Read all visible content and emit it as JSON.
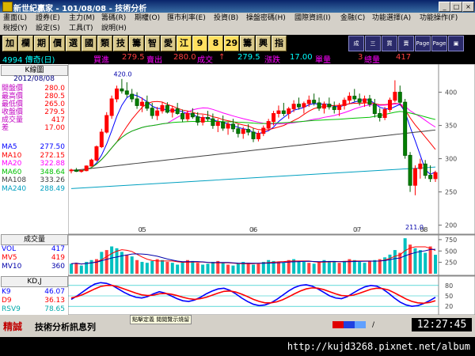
{
  "window": {
    "title": "新世紀贏家 - 101/08/08 - 技術分析",
    "btn_min": "_",
    "btn_max": "□",
    "btn_close": "×"
  },
  "menu": [
    "畫面(L)",
    "證券(E)",
    "主力(M)",
    "籌碼(R)",
    "期權(O)",
    "匯市利率(E)",
    "投資(B)",
    "操盤密碼(H)",
    "國際資訊(I)",
    "金融(C)",
    "功能選擇(A)",
    "功能操作(F)",
    "稅授(Y)",
    "設定(S)",
    "工具(T)",
    "說明(H)"
  ],
  "toolbar": {
    "buttons": [
      "加",
      "欄",
      "期",
      "價",
      "選",
      "國",
      "類",
      "技",
      "籌",
      "智",
      "愛",
      "江",
      "9",
      "8",
      "29",
      "籌",
      "興",
      "指"
    ],
    "icon_labels": [
      "成",
      "三",
      "買",
      "賣",
      "Page",
      "Page",
      "▣"
    ]
  },
  "info": {
    "code": "4994 傳奇(日)",
    "buy_label": "買進",
    "buy_value": "279.5",
    "sell_label": "賣出",
    "sell_value": "280.0",
    "trade_label": "成交",
    "arrow": "↑",
    "chg_value": "279.5",
    "vol_label": "漲跌",
    "chg": "17.00",
    "unit_label": "單量",
    "unit_value": "3",
    "total_label": "總量",
    "total_value": "417"
  },
  "left": {
    "k_header": "K線圖",
    "date": "2012/08/08",
    "ohlc": [
      {
        "label": "開盤價",
        "value": "280.0"
      },
      {
        "label": "最高價",
        "value": "280.5"
      },
      {
        "label": "最低價",
        "value": "265.0"
      },
      {
        "label": "收盤價",
        "value": "279.5"
      },
      {
        "label": "成交量",
        "value": "417"
      },
      {
        "label": "差",
        "value": "17.00"
      }
    ],
    "ma": [
      {
        "label": "MA5",
        "value": "277.50",
        "color": "#0000ff"
      },
      {
        "label": "MA10",
        "value": "272.15",
        "color": "#ff0000"
      },
      {
        "label": "MA20",
        "value": "322.88",
        "color": "#ff00ff"
      },
      {
        "label": "MA60",
        "value": "348.64",
        "color": "#00c000"
      },
      {
        "label": "MA108",
        "value": "333.26",
        "color": "#404040"
      },
      {
        "label": "MA240",
        "value": "288.49",
        "color": "#00a0c0"
      }
    ],
    "vol_header": "成交量",
    "vol": [
      {
        "label": "VOL",
        "value": "417",
        "color": "#0000ff"
      },
      {
        "label": "MV5",
        "value": "419",
        "color": "#ff0000"
      },
      {
        "label": "MV10",
        "value": "360",
        "color": "#0000aa"
      }
    ],
    "kd_header": "KD,J",
    "kd": [
      {
        "label": "K9",
        "value": "46.07",
        "color": "#0000ff"
      },
      {
        "label": "D9",
        "value": "36.13",
        "color": "#ff0000"
      },
      {
        "label": "RSV9",
        "value": "78.65",
        "color": "#00aaaa"
      }
    ]
  },
  "chart_data": [
    {
      "type": "candlestick",
      "title": "K線圖",
      "ylim": [
        190,
        440
      ],
      "yticks": [
        "400",
        "350",
        "300",
        "250",
        "200"
      ],
      "xticks": [
        "05",
        "06",
        "07",
        "08"
      ],
      "annotations": [
        "420.0",
        "211.0"
      ],
      "note": "approximate daily OHLC read from chart",
      "candles": [
        [
          282,
          285,
          278,
          283
        ],
        [
          283,
          286,
          280,
          281
        ],
        [
          281,
          284,
          279,
          282
        ],
        [
          282,
          290,
          281,
          289
        ],
        [
          289,
          300,
          288,
          298
        ],
        [
          298,
          320,
          296,
          318
        ],
        [
          318,
          345,
          316,
          340
        ],
        [
          340,
          370,
          338,
          365
        ],
        [
          365,
          395,
          360,
          390
        ],
        [
          390,
          410,
          385,
          405
        ],
        [
          405,
          420,
          398,
          402
        ],
        [
          402,
          415,
          392,
          397
        ],
        [
          397,
          405,
          385,
          390
        ],
        [
          390,
          400,
          375,
          380
        ],
        [
          380,
          392,
          370,
          385
        ],
        [
          385,
          395,
          372,
          376
        ],
        [
          376,
          384,
          360,
          365
        ],
        [
          365,
          378,
          358,
          372
        ],
        [
          372,
          385,
          368,
          380
        ],
        [
          380,
          385,
          368,
          370
        ],
        [
          370,
          380,
          362,
          375
        ],
        [
          375,
          384,
          366,
          368
        ],
        [
          368,
          374,
          355,
          360
        ],
        [
          360,
          372,
          356,
          368
        ],
        [
          368,
          376,
          360,
          363
        ],
        [
          363,
          370,
          350,
          355
        ],
        [
          355,
          366,
          350,
          362
        ],
        [
          362,
          372,
          356,
          360
        ],
        [
          360,
          368,
          345,
          350
        ],
        [
          350,
          360,
          340,
          355
        ],
        [
          355,
          365,
          342,
          346
        ],
        [
          346,
          356,
          336,
          352
        ],
        [
          352,
          360,
          340,
          345
        ],
        [
          345,
          352,
          332,
          338
        ],
        [
          338,
          348,
          330,
          344
        ],
        [
          344,
          352,
          335,
          340
        ],
        [
          340,
          346,
          325,
          330
        ],
        [
          330,
          342,
          326,
          338
        ],
        [
          338,
          350,
          334,
          346
        ],
        [
          346,
          360,
          342,
          356
        ],
        [
          356,
          372,
          350,
          368
        ],
        [
          368,
          380,
          362,
          372
        ],
        [
          372,
          384,
          364,
          368
        ],
        [
          368,
          378,
          360,
          375
        ],
        [
          375,
          388,
          370,
          382
        ],
        [
          382,
          392,
          374,
          378
        ],
        [
          378,
          386,
          368,
          383
        ],
        [
          383,
          395,
          378,
          388
        ],
        [
          388,
          398,
          380,
          384
        ],
        [
          384,
          392,
          372,
          376
        ],
        [
          376,
          386,
          368,
          382
        ],
        [
          382,
          392,
          374,
          378
        ],
        [
          378,
          386,
          368,
          374
        ],
        [
          374,
          384,
          364,
          380
        ],
        [
          380,
          392,
          374,
          388
        ],
        [
          388,
          400,
          382,
          394
        ],
        [
          394,
          405,
          386,
          390
        ],
        [
          390,
          398,
          380,
          385
        ],
        [
          385,
          395,
          378,
          390
        ],
        [
          390,
          396,
          378,
          382
        ],
        [
          382,
          390,
          362,
          368
        ],
        [
          368,
          376,
          356,
          362
        ],
        [
          362,
          378,
          358,
          374
        ],
        [
          374,
          392,
          370,
          388
        ],
        [
          388,
          418,
          385,
          400
        ],
        [
          400,
          410,
          380,
          385
        ],
        [
          385,
          390,
          300,
          305
        ],
        [
          305,
          310,
          250,
          260
        ],
        [
          260,
          290,
          245,
          285
        ],
        [
          285,
          300,
          270,
          292
        ],
        [
          292,
          298,
          270,
          275
        ],
        [
          275,
          290,
          265,
          270
        ],
        [
          270,
          282,
          265,
          279
        ]
      ],
      "series": [
        {
          "name": "MA5",
          "color": "#0000ff"
        },
        {
          "name": "MA10",
          "color": "#ff0000"
        },
        {
          "name": "MA20",
          "color": "#ff00ff"
        },
        {
          "name": "MA60",
          "color": "#00c000"
        },
        {
          "name": "MA108",
          "color": "#404040"
        },
        {
          "name": "MA240",
          "color": "#00a0c0"
        }
      ]
    },
    {
      "type": "bar",
      "title": "成交量",
      "ylim": [
        0,
        800
      ],
      "yticks": [
        "750",
        "500",
        "250"
      ],
      "values": [
        220,
        240,
        180,
        260,
        300,
        320,
        480,
        520,
        600,
        560,
        480,
        420,
        380,
        300,
        260,
        240,
        280,
        320,
        300,
        260,
        240,
        200,
        260,
        300,
        280,
        240,
        200,
        220,
        260,
        280,
        240,
        200,
        180,
        220,
        260,
        240,
        200,
        220,
        260,
        300,
        280,
        260,
        240,
        300,
        320,
        280,
        260,
        240,
        220,
        260,
        300,
        280,
        260,
        240,
        280,
        320,
        300,
        260,
        240,
        280,
        300,
        320,
        360,
        420,
        520,
        460,
        780,
        640,
        560,
        520,
        460,
        600,
        417
      ]
    },
    {
      "type": "line",
      "title": "KD,J",
      "ylim": [
        0,
        100
      ],
      "yticks": [
        "80",
        "50",
        "20"
      ],
      "series": [
        {
          "name": "K9",
          "color": "#0000ff",
          "values": [
            40,
            50,
            62,
            74,
            84,
            88,
            86,
            80,
            70,
            60,
            52,
            46,
            44,
            48,
            56,
            62,
            58,
            50,
            42,
            36,
            34,
            38,
            46,
            56,
            64,
            70,
            72,
            66,
            56,
            44,
            34,
            26,
            22,
            24,
            30,
            40,
            52,
            64,
            74,
            80,
            82,
            78,
            70,
            60,
            50,
            44,
            42,
            48,
            58,
            68,
            76,
            80,
            78,
            70,
            58,
            44,
            32,
            24,
            20,
            22,
            28,
            36,
            46
          ]
        },
        {
          "name": "D9",
          "color": "#ff0000",
          "values": [
            44,
            48,
            54,
            62,
            70,
            77,
            80,
            80,
            76,
            70,
            64,
            58,
            53,
            51,
            52,
            56,
            57,
            55,
            51,
            46,
            42,
            40,
            42,
            46,
            52,
            58,
            63,
            64,
            61,
            55,
            48,
            40,
            34,
            30,
            30,
            33,
            39,
            47,
            56,
            64,
            70,
            73,
            72,
            68,
            62,
            56,
            51,
            50,
            52,
            57,
            63,
            69,
            72,
            71,
            67,
            59,
            50,
            41,
            34,
            30,
            29,
            31,
            36
          ]
        },
        {
          "name": "RSV9",
          "color": "#00aaaa",
          "values": []
        }
      ]
    }
  ],
  "status": {
    "brand": "精誠",
    "message": "技術分析訊息列",
    "clock": "12:27:45",
    "clock_sep": "/",
    "popup": "點擊定義 閱閱覽示燒留"
  },
  "watermark": "http://kujd3268.pixnet.net/album"
}
